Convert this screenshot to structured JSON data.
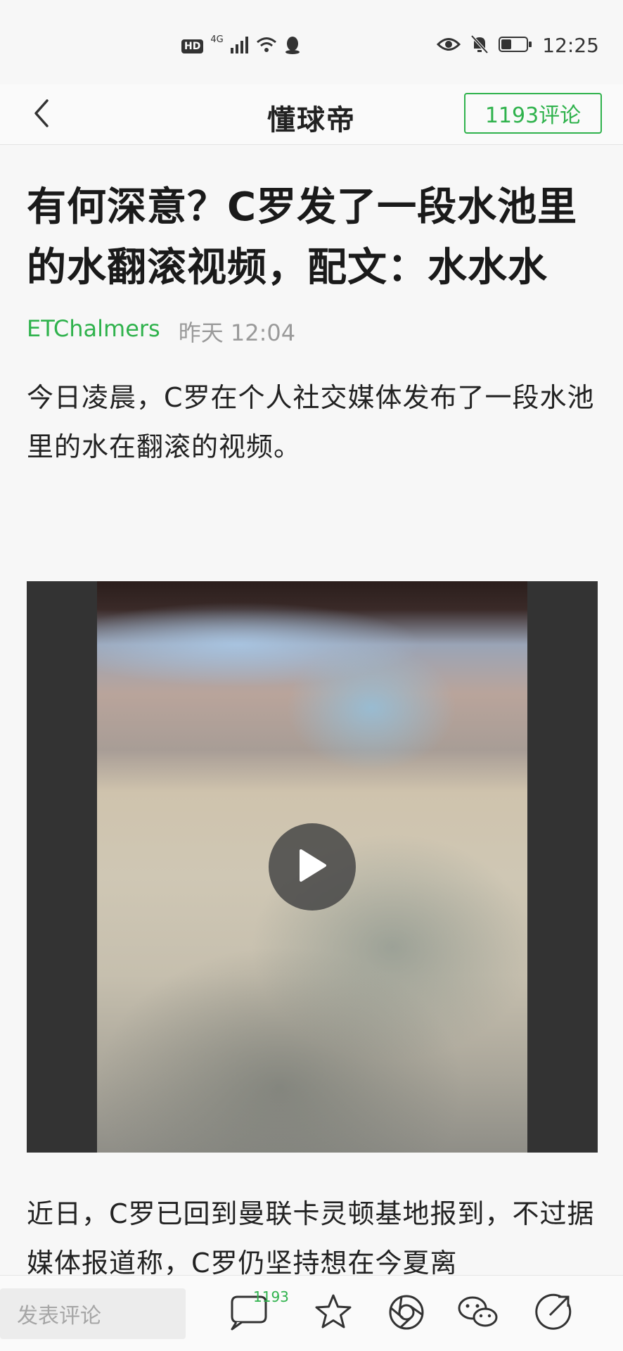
{
  "status_bar": {
    "hd": "HD",
    "network": "4G",
    "time": "12:25"
  },
  "nav": {
    "title": "懂球帝",
    "comment_count_label": "1193评论"
  },
  "article": {
    "title": "有何深意？C罗发了一段水池里的水翻滚视频，配文：水水水",
    "author": "ETChalmers",
    "time": "昨天 12:04",
    "paragraph1": "今日凌晨，C罗在个人社交媒体发布了一段水池里的水在翻滚的视频。",
    "paragraph2": "近日，C罗已回到曼联卡灵顿基地报到，不过据媒体报道称，C罗仍坚持想在今夏离"
  },
  "bottom_bar": {
    "comment_placeholder": "发表评论",
    "comment_badge": "1193",
    "icons": [
      "comment-icon",
      "star-icon",
      "moments-icon",
      "wechat-icon",
      "share-icon"
    ]
  },
  "colors": {
    "accent": "#2fb24c",
    "video_bg": "#333333"
  }
}
